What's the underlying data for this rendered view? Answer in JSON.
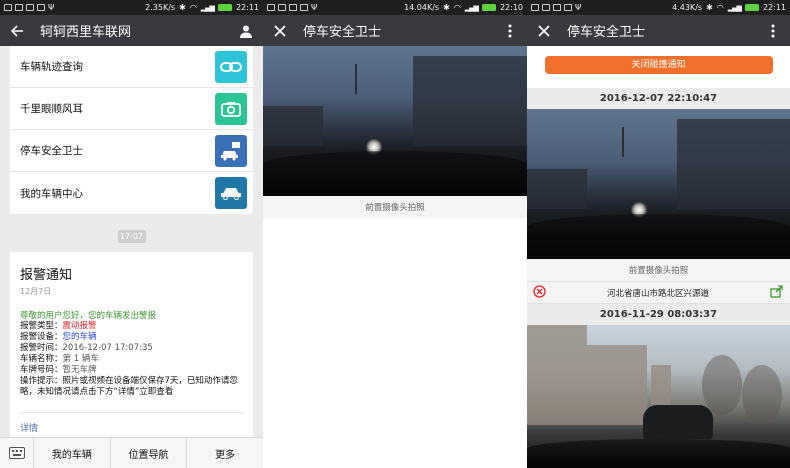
{
  "colors": {
    "titlebar": "#393a3f",
    "statusbar": "#1f1f1f",
    "accent_orange": "#f0702b",
    "green": "#3a9b2e",
    "red": "#e8242b",
    "blue": "#2b49d8",
    "link": "#4a6fb5"
  },
  "screen1": {
    "status": {
      "speed": "2.35K/s",
      "time": "22:11"
    },
    "title": "轲轲西里车联网",
    "menu": [
      {
        "label": "车辆轨迹查询",
        "icon": "link-chain-icon",
        "color": "#2ec4d8"
      },
      {
        "label": "千里眼顺风耳",
        "icon": "camera-icon",
        "color": "#2bc497"
      },
      {
        "label": "停车安全卫士",
        "icon": "parking-car-icon",
        "color": "#3b6fb8"
      },
      {
        "label": "我的车辆中心",
        "icon": "car-icon",
        "color": "#1f78a8"
      }
    ],
    "time_pill": "17:07",
    "alert": {
      "title": "报警通知",
      "date": "12月7日",
      "greeting": "尊敬的用户您好，您的车辆发出警报",
      "rows": [
        {
          "k": "报警类型：",
          "v": "震动报警",
          "style": "red"
        },
        {
          "k": "报警设备：",
          "v": "您的车辆",
          "style": "blue"
        },
        {
          "k": "报警时间：",
          "v": "2016-12-07 17:07:35",
          "style": ""
        },
        {
          "k": "车辆名称：",
          "v": "第 1 辆车",
          "style": ""
        },
        {
          "k": "车牌号码：",
          "v": "暂无车牌",
          "style": ""
        }
      ],
      "tip_key": "操作提示：",
      "tip_value": "照片或视频在设备端仅保存7天，已知动作请忽略，未知情况请点击下方“详情”立即查看",
      "detail": "详情"
    },
    "nav": [
      "我的车辆",
      "位置导航",
      "更多"
    ]
  },
  "screen2": {
    "status": {
      "speed": "14.04K/s",
      "time": "22:10"
    },
    "title": "停车安全卫士",
    "caption": "前置摄像头拍照"
  },
  "screen3": {
    "status": {
      "speed": "4.43K/s",
      "time": "22:11"
    },
    "title": "停车安全卫士",
    "close_button": "关闭碰撞通知",
    "records": [
      {
        "timestamp": "2016-12-07 22:10:47",
        "caption": "前置摄像头拍照",
        "location": "河北省唐山市路北区兴源道"
      },
      {
        "timestamp": "2016-11-29 08:03:37"
      }
    ]
  }
}
